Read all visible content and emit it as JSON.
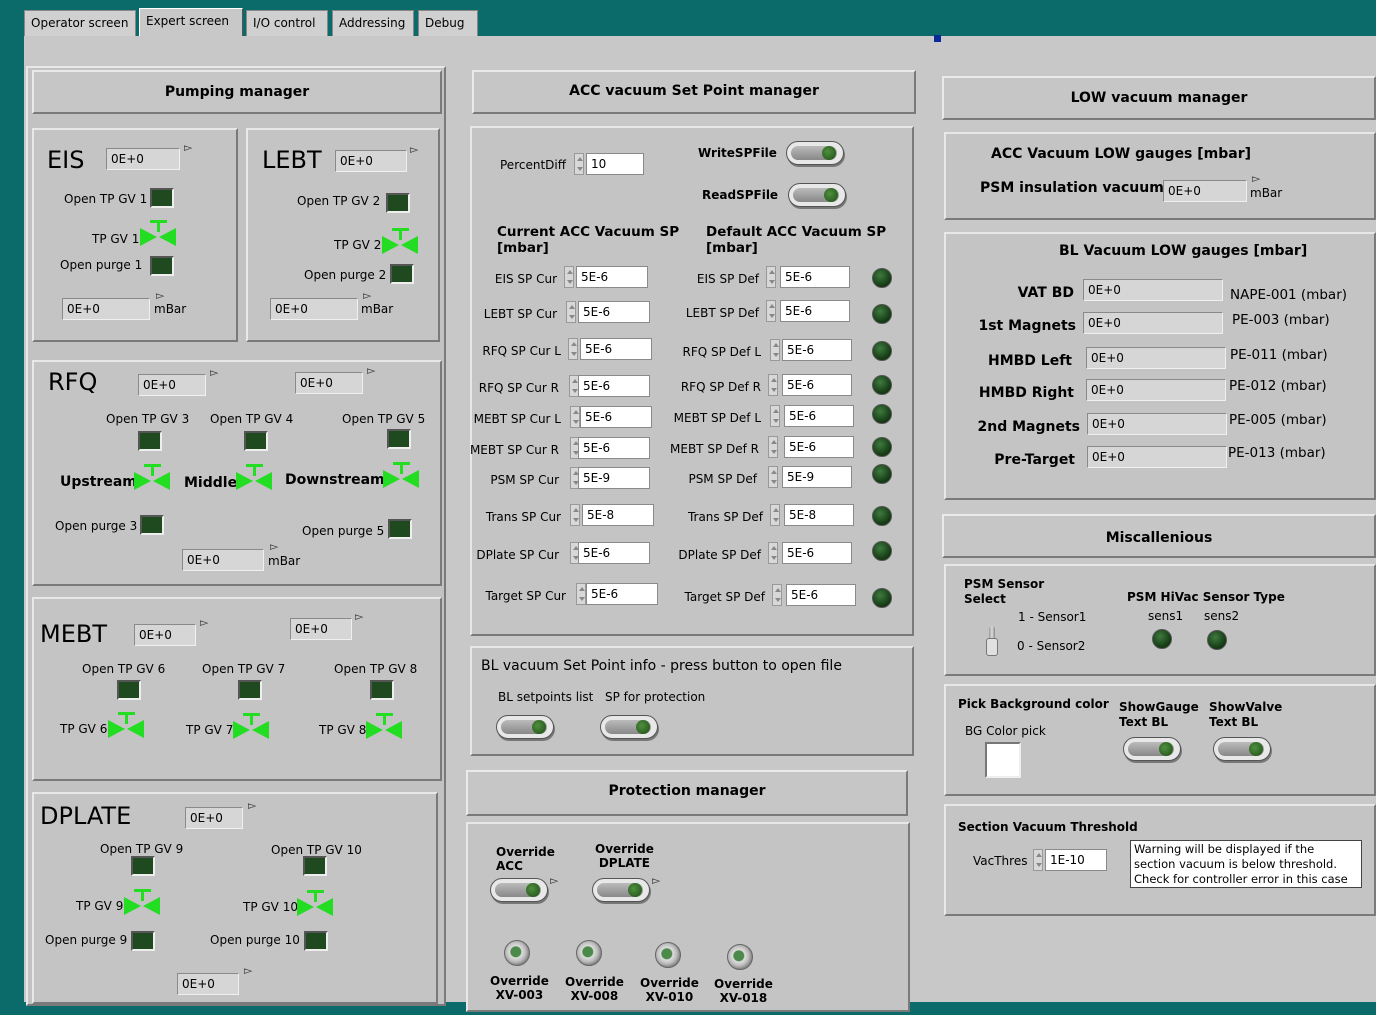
{
  "tabs": [
    "Operator screen",
    "Expert screen",
    "I/O control",
    "Addressing",
    "Debug"
  ],
  "pumping": {
    "title": "Pumping  manager",
    "unit": "mBar",
    "eis": {
      "name": "EIS",
      "value": "0E+0",
      "open_gv": "Open TP GV 1",
      "gv": "TP GV 1",
      "open_purge": "Open purge 1",
      "pressure": "0E+0"
    },
    "lebt": {
      "name": "LEBT",
      "value": "0E+0",
      "open_gv": "Open  TP GV 2",
      "gv": "TP GV 2",
      "open_purge": "Open purge 2",
      "pressure": "0E+0"
    },
    "rfq": {
      "name": "RFQ",
      "value1": "0E+0",
      "value2": "0E+0",
      "open_gv3": "Open  TP GV 3",
      "open_gv4": "Open  TP GV 4",
      "open_gv5": "Open  TP GV 5",
      "upstream": "Upstream",
      "middle": "Middle",
      "downstream": "Downstream",
      "open_purge3": "Open purge 3",
      "open_purge5": "Open purge 5",
      "pressure": "0E+0"
    },
    "mebt": {
      "name": "MEBT",
      "value1": "0E+0",
      "value2": "0E+0",
      "open_gv6": "Open  TP GV 6",
      "open_gv7": "Open  TP GV 7",
      "open_gv8": "Open  TP GV 8",
      "gv6": "TP GV 6",
      "gv7": "TP GV 7",
      "gv8": "TP GV 8"
    },
    "dplate": {
      "name": "DPLATE",
      "value": "0E+0",
      "open_gv9": "Open  TP GV 9",
      "open_gv10": "Open  TP GV 10",
      "gv9": "TP GV 9",
      "gv10": "TP GV 10",
      "open_purge9": "Open purge 9",
      "open_purge10": "Open purge 10",
      "pressure": "0E+0"
    }
  },
  "acc_sp": {
    "title": "ACC vacuum Set Point manager",
    "percentdiff_label": "PercentDiff",
    "percentdiff": "10",
    "write_label": "WriteSPFile",
    "read_label": "ReadSPFile",
    "current_header": "Current ACC Vacuum SP\n[mbar]",
    "default_header": "Default ACC Vacuum SP\n[mbar]",
    "rows": [
      {
        "cur_label": "EIS SP Cur",
        "cur": "5E-6",
        "def_label": "EIS SP Def",
        "def": "5E-6"
      },
      {
        "cur_label": "LEBT SP Cur",
        "cur": "5E-6",
        "def_label": "LEBT SP Def",
        "def": "5E-6"
      },
      {
        "cur_label": "RFQ SP Cur L",
        "cur": "5E-6",
        "def_label": "RFQ SP Def L",
        "def": "5E-6"
      },
      {
        "cur_label": "RFQ SP Cur R",
        "cur": "5E-6",
        "def_label": "RFQ SP Def R",
        "def": "5E-6"
      },
      {
        "cur_label": "MEBT SP Cur L",
        "cur": "5E-6",
        "def_label": "MEBT SP Def L",
        "def": "5E-6"
      },
      {
        "cur_label": "MEBT SP Cur R",
        "cur": "5E-6",
        "def_label": "MEBT SP Def R",
        "def": "5E-6"
      },
      {
        "cur_label": "PSM SP Cur",
        "cur": "5E-9",
        "def_label": "PSM SP Def",
        "def": "5E-9"
      },
      {
        "cur_label": "Trans SP Cur",
        "cur": "5E-8",
        "def_label": "Trans SP Def",
        "def": "5E-8"
      },
      {
        "cur_label": "DPlate SP Cur",
        "cur": "5E-6",
        "def_label": "DPlate SP Def",
        "def": "5E-6"
      },
      {
        "cur_label": "Target SP Cur",
        "cur": "5E-6",
        "def_label": "Target SP Def",
        "def": "5E-6"
      }
    ]
  },
  "bl_sp": {
    "title": "BL vacuum Set Point info - press button to open file",
    "btn1": "BL setpoints list",
    "btn2": "SP for protection"
  },
  "protection": {
    "title": "Protection manager",
    "override_acc": "Override\nACC",
    "override_dplate": "Override\nDPLATE",
    "overrides": [
      "Override\nXV-003",
      "Override\nXV-008",
      "Override\nXV-010",
      "Override\nXV-018"
    ]
  },
  "low": {
    "title": "LOW vacuum manager",
    "acc_title": "ACC Vacuum LOW gauges [mbar]",
    "psm_label": "PSM insulation vacuum",
    "psm_value": "0E+0",
    "psm_unit": "mBar",
    "bl_title": "BL Vacuum LOW gauges [mbar]",
    "gauges": [
      {
        "label": "VAT BD",
        "value": "0E+0",
        "tag": "NAPE-001 (mbar)"
      },
      {
        "label": "1st Magnets",
        "value": "0E+0",
        "tag": "PE-003 (mbar)"
      },
      {
        "label": "HMBD Left",
        "value": "0E+0",
        "tag": "PE-011 (mbar)"
      },
      {
        "label": "HMBD Right",
        "value": "0E+0",
        "tag": "PE-012 (mbar)"
      },
      {
        "label": "2nd Magnets",
        "value": "0E+0",
        "tag": "PE-005 (mbar)"
      },
      {
        "label": "Pre-Target",
        "value": "0E+0",
        "tag": "PE-013 (mbar)"
      }
    ]
  },
  "misc": {
    "title": "Miscallenious",
    "psm_sensor_select": "PSM Sensor\nSelect",
    "sensor1": "1 - Sensor1",
    "sensor2": "0 - Sensor2",
    "hivac_title": "PSM HiVac Sensor Type",
    "sens1": "sens1",
    "sens2": "sens2",
    "pick_bg": "Pick Background color",
    "bg_pick": "BG Color pick",
    "show_gauge": "ShowGauge\nText BL",
    "show_valve": "ShowValve\nText BL",
    "threshold_title": "Section Vacuum Threshold",
    "vacthres_label": "VacThres",
    "vacthres": "1E-10",
    "warning": "Warning will be displayed if the section vacuum is below threshold.\nCheck for controller error in this case"
  }
}
